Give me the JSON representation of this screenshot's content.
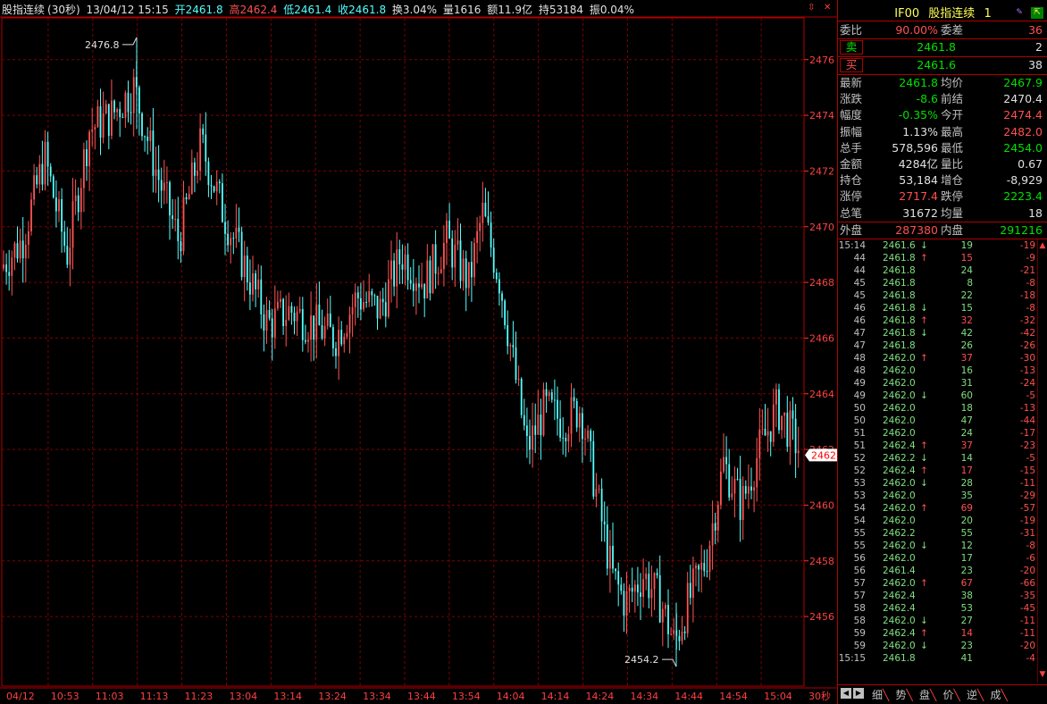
{
  "header": {
    "name": "股指连续",
    "period": "(30秒)",
    "datetime": "13/04/12 15:15",
    "open": "开2461.8",
    "high": "高2462.4",
    "low": "低2461.4",
    "close": "收2461.8",
    "turnover_rate": "换3.04%",
    "volume": "量1616",
    "amount": "额11.9亿",
    "open_interest": "持53184",
    "amplitude": "振0.04%"
  },
  "chart": {
    "high_label": "2476.8",
    "low_label": "2454.2",
    "current_price_tag": "2462",
    "y_labels": [
      "2476",
      "2474",
      "2472",
      "2470",
      "2468",
      "2466",
      "2464",
      "2462",
      "2460",
      "2458",
      "2456"
    ],
    "x_labels": [
      "04/12",
      "10:53",
      "11:03",
      "11:13",
      "11:23",
      "13:04",
      "13:14",
      "13:24",
      "13:34",
      "13:44",
      "13:54",
      "14:04",
      "14:14",
      "14:24",
      "14:34",
      "14:44",
      "14:54",
      "15:04"
    ],
    "period_label": "30秒",
    "colors": {
      "up": "#ff5454",
      "down": "#54ffff",
      "grid": "#800000",
      "axis": "#ff3030"
    }
  },
  "chart_data": {
    "type": "candlestick",
    "title": "",
    "ylim": [
      2453.5,
      2477.5
    ],
    "high_point": 2476.8,
    "low_point": 2454.2,
    "trend": [
      [
        0,
        2468.5
      ],
      [
        25,
        2469.5
      ],
      [
        50,
        2472.5
      ],
      [
        75,
        2469
      ],
      [
        100,
        2473.5
      ],
      [
        125,
        2474
      ],
      [
        150,
        2475
      ],
      [
        175,
        2472
      ],
      [
        200,
        2469.5
      ],
      [
        225,
        2473
      ],
      [
        250,
        2470.5
      ],
      [
        275,
        2468.5
      ],
      [
        300,
        2466.5
      ],
      [
        325,
        2467
      ],
      [
        350,
        2466.5
      ],
      [
        375,
        2466
      ],
      [
        400,
        2467.5
      ],
      [
        425,
        2467
      ],
      [
        450,
        2469
      ],
      [
        475,
        2468
      ],
      [
        500,
        2469.5
      ],
      [
        525,
        2468
      ],
      [
        540,
        2470.5
      ],
      [
        560,
        2468
      ],
      [
        575,
        2465
      ],
      [
        590,
        2462
      ],
      [
        610,
        2463.5
      ],
      [
        630,
        2463
      ],
      [
        650,
        2463.5
      ],
      [
        670,
        2460
      ],
      [
        685,
        2457.5
      ],
      [
        700,
        2456.5
      ],
      [
        720,
        2457.5
      ],
      [
        740,
        2456.5
      ],
      [
        755,
        2455
      ],
      [
        770,
        2456.5
      ],
      [
        790,
        2458
      ],
      [
        810,
        2461.5
      ],
      [
        830,
        2460
      ],
      [
        850,
        2462
      ],
      [
        870,
        2463.5
      ],
      [
        895,
        2462
      ]
    ]
  },
  "panel": {
    "code": "IF00",
    "name": "股指连续",
    "suffix": "1",
    "wei_bi_label": "委比",
    "wei_bi": "90.00%",
    "wei_cha_label": "委差",
    "wei_cha": "36",
    "sell_label": "卖",
    "sell_price": "2461.8",
    "sell_vol": "2",
    "buy_label": "买",
    "buy_price": "2461.6",
    "buy_vol": "38",
    "stats": [
      {
        "l1": "最新",
        "v1": "2461.8",
        "c1": "#00e000",
        "l2": "均价",
        "v2": "2467.9",
        "c2": "#00e000"
      },
      {
        "l1": "涨跌",
        "v1": "-8.6",
        "c1": "#00e000",
        "l2": "前结",
        "v2": "2470.4",
        "c2": "#e0e0e0"
      },
      {
        "l1": "幅度",
        "v1": "-0.35%",
        "c1": "#00e000",
        "l2": "今开",
        "v2": "2474.4",
        "c2": "#ff5050"
      },
      {
        "l1": "振幅",
        "v1": "1.13%",
        "c1": "#e0e0e0",
        "l2": "最高",
        "v2": "2482.0",
        "c2": "#ff5050"
      },
      {
        "l1": "总手",
        "v1": "578,596",
        "c1": "#e0e0e0",
        "l2": "最低",
        "v2": "2454.0",
        "c2": "#00e000"
      },
      {
        "l1": "金额",
        "v1": "4284亿",
        "c1": "#e0e0e0",
        "l2": "量比",
        "v2": "0.67",
        "c2": "#e0e0e0"
      },
      {
        "l1": "持仓",
        "v1": "53,184",
        "c1": "#e0e0e0",
        "l2": "增仓",
        "v2": "-8,929",
        "c2": "#e0e0e0"
      },
      {
        "l1": "涨停",
        "v1": "2717.4",
        "c1": "#ff5050",
        "l2": "跌停",
        "v2": "2223.4",
        "c2": "#00e000"
      },
      {
        "l1": "总笔",
        "v1": "31672",
        "c1": "#e0e0e0",
        "l2": "均量",
        "v2": "18",
        "c2": "#e0e0e0"
      }
    ],
    "outer_label": "外盘",
    "outer": "287380",
    "inner_label": "内盘",
    "inner": "291216",
    "ticks": [
      {
        "t": "15:14",
        "p": "2461.6",
        "a": "↓",
        "v": "19",
        "d": "-19"
      },
      {
        "t": "44",
        "p": "2461.8",
        "a": "↑",
        "v": "15",
        "d": "-9"
      },
      {
        "t": "44",
        "p": "2461.8",
        "a": "",
        "v": "24",
        "d": "-21"
      },
      {
        "t": "45",
        "p": "2461.8",
        "a": "",
        "v": "8",
        "d": "-8"
      },
      {
        "t": "45",
        "p": "2461.8",
        "a": "",
        "v": "22",
        "d": "-18"
      },
      {
        "t": "46",
        "p": "2461.8",
        "a": "↓",
        "v": "15",
        "d": "-8"
      },
      {
        "t": "46",
        "p": "2461.8",
        "a": "↑",
        "v": "32",
        "d": "-32"
      },
      {
        "t": "47",
        "p": "2461.8",
        "a": "↓",
        "v": "42",
        "d": "-42"
      },
      {
        "t": "47",
        "p": "2461.8",
        "a": "",
        "v": "26",
        "d": "-26"
      },
      {
        "t": "48",
        "p": "2462.0",
        "a": "↑",
        "v": "37",
        "d": "-30"
      },
      {
        "t": "48",
        "p": "2462.0",
        "a": "",
        "v": "16",
        "d": "-13"
      },
      {
        "t": "49",
        "p": "2462.0",
        "a": "",
        "v": "31",
        "d": "-24"
      },
      {
        "t": "49",
        "p": "2462.0",
        "a": "↓",
        "v": "60",
        "d": "-5"
      },
      {
        "t": "50",
        "p": "2462.0",
        "a": "",
        "v": "18",
        "d": "-13"
      },
      {
        "t": "50",
        "p": "2462.0",
        "a": "",
        "v": "47",
        "d": "-44"
      },
      {
        "t": "51",
        "p": "2462.0",
        "a": "",
        "v": "24",
        "d": "-17"
      },
      {
        "t": "51",
        "p": "2462.4",
        "a": "↑",
        "v": "37",
        "d": "-23"
      },
      {
        "t": "52",
        "p": "2462.2",
        "a": "↓",
        "v": "14",
        "d": "-5"
      },
      {
        "t": "52",
        "p": "2462.4",
        "a": "↑",
        "v": "17",
        "d": "-15"
      },
      {
        "t": "53",
        "p": "2462.0",
        "a": "↓",
        "v": "28",
        "d": "-11"
      },
      {
        "t": "53",
        "p": "2462.0",
        "a": "",
        "v": "35",
        "d": "-29"
      },
      {
        "t": "54",
        "p": "2462.0",
        "a": "↑",
        "v": "69",
        "d": "-57"
      },
      {
        "t": "54",
        "p": "2462.0",
        "a": "",
        "v": "20",
        "d": "-19"
      },
      {
        "t": "55",
        "p": "2462.2",
        "a": "",
        "v": "55",
        "d": "-31"
      },
      {
        "t": "55",
        "p": "2462.0",
        "a": "↓",
        "v": "12",
        "d": "-8"
      },
      {
        "t": "56",
        "p": "2462.0",
        "a": "",
        "v": "17",
        "d": "-6"
      },
      {
        "t": "56",
        "p": "2461.4",
        "a": "",
        "v": "23",
        "d": "-20"
      },
      {
        "t": "57",
        "p": "2462.0",
        "a": "↑",
        "v": "67",
        "d": "-66"
      },
      {
        "t": "57",
        "p": "2462.4",
        "a": "",
        "v": "38",
        "d": "-35"
      },
      {
        "t": "58",
        "p": "2462.4",
        "a": "",
        "v": "53",
        "d": "-45"
      },
      {
        "t": "58",
        "p": "2462.0",
        "a": "↓",
        "v": "27",
        "d": "-11"
      },
      {
        "t": "59",
        "p": "2462.4",
        "a": "↑",
        "v": "14",
        "d": "-11"
      },
      {
        "t": "59",
        "p": "2462.0",
        "a": "↓",
        "v": "23",
        "d": "-20"
      },
      {
        "t": "15:15",
        "p": "2461.8",
        "a": "",
        "v": "41",
        "d": "-4"
      }
    ],
    "tabs": [
      "细",
      "势",
      "盘",
      "价",
      "逆",
      "成"
    ]
  }
}
